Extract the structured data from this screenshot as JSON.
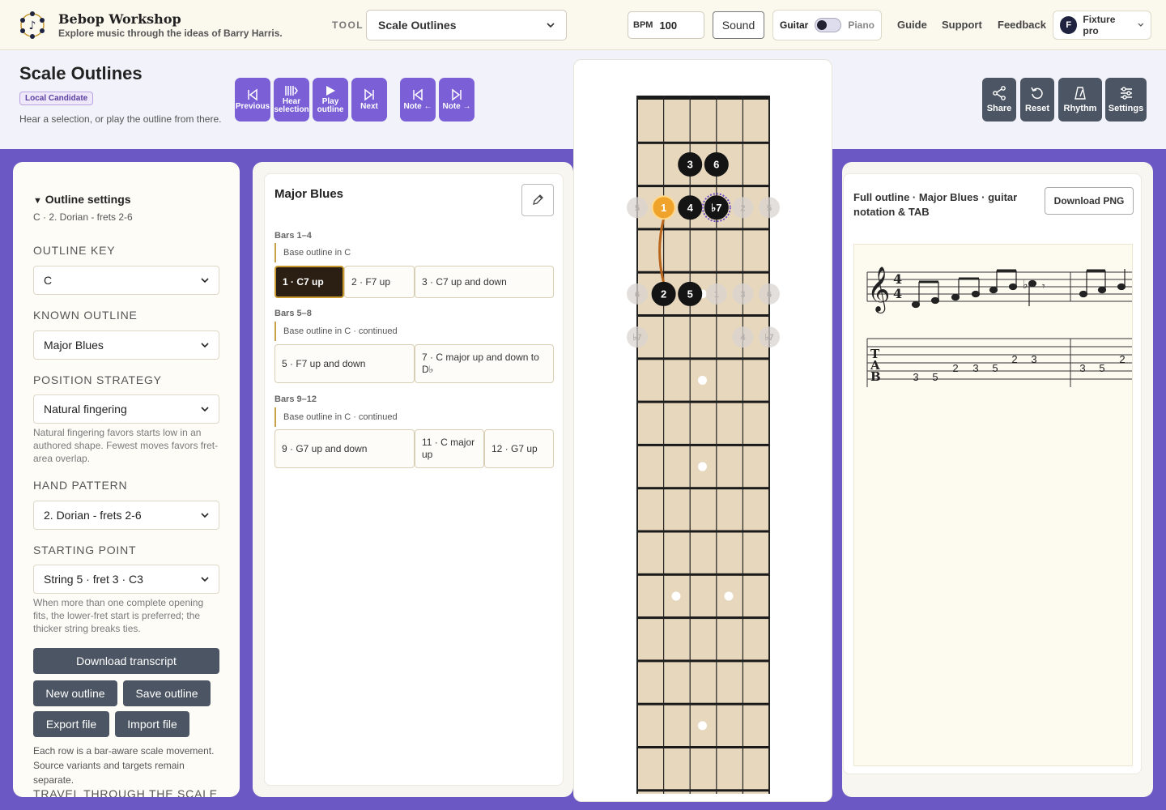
{
  "brand": {
    "title": "Bebop Workshop",
    "subtitle": "Explore music through the ideas of Barry Harris."
  },
  "toolbar": {
    "tool_label": "TOOL",
    "tool_value": "Scale Outlines",
    "bpm_label": "BPM",
    "bpm_value": "100",
    "sound_label": "Sound",
    "instrument_left": "Guitar",
    "instrument_right": "Piano",
    "links": [
      "Guide",
      "Support",
      "Feedback"
    ],
    "user_initial": "F",
    "user_label": "Fixture pro"
  },
  "page": {
    "title": "Scale Outlines",
    "badge": "Local Candidate",
    "description": "Hear a selection, or play the outline from there."
  },
  "transport": {
    "previous": "Previous",
    "hear_1": "Hear",
    "hear_2": "selection",
    "play_1": "Play",
    "play_2": "outline",
    "next": "Next",
    "note_prev": "Note ←",
    "note_next": "Note →"
  },
  "actions": {
    "share": "Share",
    "reset": "Reset",
    "rhythm": "Rhythm",
    "settings": "Settings"
  },
  "settings": {
    "section_title": "Outline settings",
    "summary": "C · 2. Dorian - frets 2-6",
    "outline_key_label": "OUTLINE KEY",
    "outline_key": "C",
    "known_outline_label": "KNOWN OUTLINE",
    "known_outline": "Major Blues",
    "position_label": "POSITION STRATEGY",
    "position": "Natural fingering",
    "position_hint": "Natural fingering favors starts low in an authored shape. Fewest moves favors fret-area overlap.",
    "hand_label": "HAND PATTERN",
    "hand": "2. Dorian - frets 2-6",
    "start_label": "STARTING POINT",
    "start": "String 5 · fret 3 · C3",
    "start_hint": "When more than one complete opening fits, the lower-fret start is preferred; the thicker string breaks ties.",
    "download_transcript": "Download transcript",
    "new_outline": "New outline",
    "save_outline": "Save outline",
    "export_file": "Export file",
    "import_file": "Import file",
    "footer_text": "Each row is a bar-aware scale movement. Source variants and targets remain separate.",
    "cut_label": "TRAVEL THROUGH THE SCALE"
  },
  "outline": {
    "title": "Major Blues",
    "groups": [
      {
        "bars": "Bars 1–4",
        "base": "Base outline in C",
        "chips": [
          "1 · C7 up",
          "2 · F7 up",
          "3 · C7 up and down"
        ]
      },
      {
        "bars": "Bars 5–8",
        "base": "Base outline in C · continued",
        "chips": [
          "5 · F7 up and down",
          "7 · C major up and down to D♭"
        ]
      },
      {
        "bars": "Bars 9–12",
        "base": "Base outline in C · continued",
        "chips": [
          "9 · G7 up and down",
          "11 · C major up",
          "12 · G7 up"
        ]
      }
    ]
  },
  "fretboard": {
    "active_notes": [
      {
        "fret": 2,
        "string": 3,
        "label": "3"
      },
      {
        "fret": 2,
        "string": 4,
        "label": "6"
      },
      {
        "fret": 3,
        "string": 2,
        "label": "1",
        "current": true
      },
      {
        "fret": 3,
        "string": 3,
        "label": "4"
      },
      {
        "fret": 3,
        "string": 4,
        "label": "♭7",
        "ring": true
      },
      {
        "fret": 5,
        "string": 2,
        "label": "2"
      },
      {
        "fret": 5,
        "string": 3,
        "label": "5"
      }
    ],
    "ghost_notes": [
      {
        "fret": 3,
        "string": 1,
        "label": "5"
      },
      {
        "fret": 3,
        "string": 5,
        "label": "2"
      },
      {
        "fret": 3,
        "string": 6,
        "label": "5"
      },
      {
        "fret": 5,
        "string": 1,
        "label": "6"
      },
      {
        "fret": 5,
        "string": 4,
        "label": "1"
      },
      {
        "fret": 5,
        "string": 5,
        "label": "3"
      },
      {
        "fret": 5,
        "string": 6,
        "label": "6"
      },
      {
        "fret": 6,
        "string": 1,
        "label": "♭7"
      },
      {
        "fret": 6,
        "string": 5,
        "label": "4"
      },
      {
        "fret": 6,
        "string": 6,
        "label": "♭7"
      }
    ]
  },
  "notation": {
    "title": "Full outline · Major Blues · guitar notation & TAB",
    "download_png": "Download PNG",
    "time_top": "4",
    "time_bottom": "4",
    "tab_numbers": [
      "3",
      "5",
      "2",
      "3",
      "5",
      "2",
      "3",
      "3",
      "5",
      "2"
    ]
  }
}
